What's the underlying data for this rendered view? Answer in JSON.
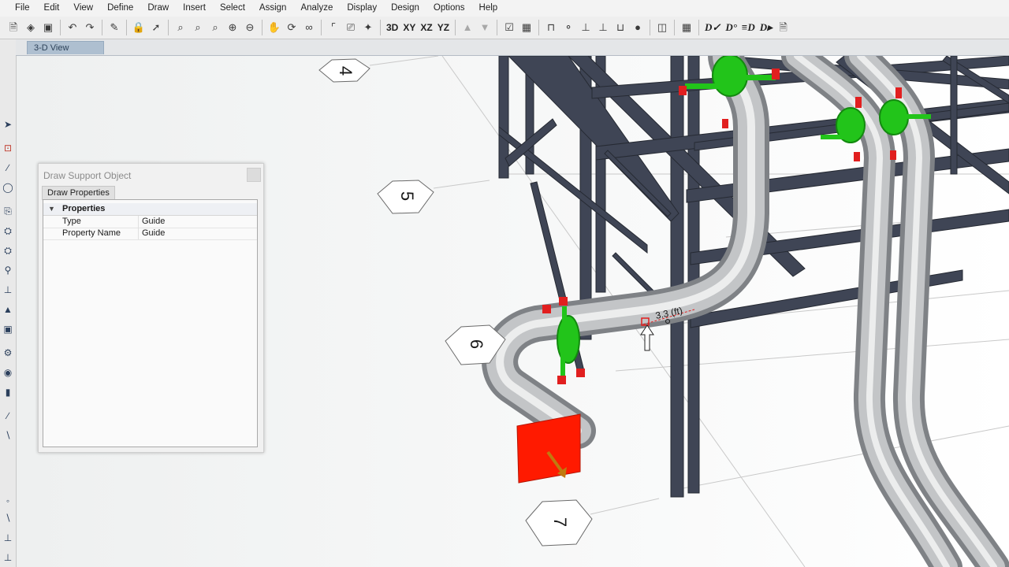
{
  "menu": [
    "File",
    "Edit",
    "View",
    "Define",
    "Draw",
    "Insert",
    "Select",
    "Assign",
    "Analyze",
    "Display",
    "Design",
    "Options",
    "Help"
  ],
  "toolbar": {
    "view_buttons": [
      "3D",
      "XY",
      "XZ",
      "YZ"
    ],
    "design_buttons": [
      "D✓",
      "D°",
      "≡D",
      "D▸"
    ]
  },
  "tab": {
    "label": "3-D View"
  },
  "dialog": {
    "title": "Draw Support Object",
    "tab": "Draw Properties",
    "section": "Properties",
    "rows": [
      {
        "key": "Type",
        "value": "Guide"
      },
      {
        "key": "Property Name",
        "value": "Guide"
      }
    ]
  },
  "viewport": {
    "grid_bubbles": [
      "4",
      "5",
      "6",
      "7"
    ],
    "dimension_label": "3.3 (ft)"
  },
  "colors": {
    "steel": "#3f4555",
    "pipe": "#b9bcbf",
    "support_green": "#22c41a",
    "support_red": "#e11f1f",
    "anchor_red": "#ff1a00"
  }
}
